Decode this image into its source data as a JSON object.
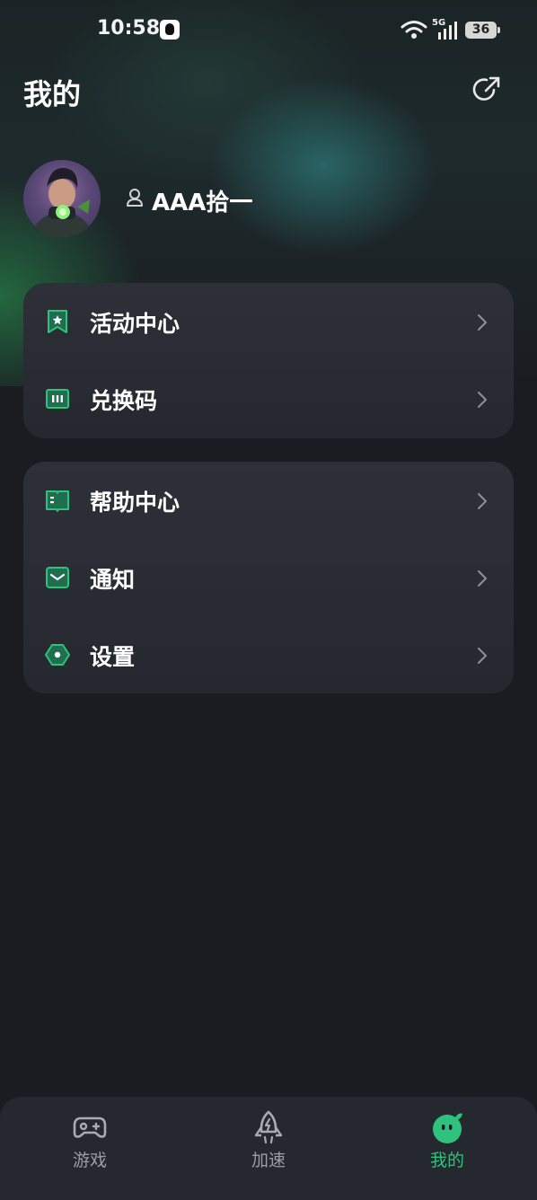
{
  "status_bar": {
    "time": "10:58",
    "network": "5G",
    "battery": "36"
  },
  "header": {
    "title": "我的"
  },
  "profile": {
    "username": "AAA拾一"
  },
  "menu_group_1": [
    {
      "label": "活动中心",
      "icon": "bookmark-star-icon"
    },
    {
      "label": "兑换码",
      "icon": "ticket-icon"
    }
  ],
  "menu_group_2": [
    {
      "label": "帮助中心",
      "icon": "book-icon"
    },
    {
      "label": "通知",
      "icon": "mail-icon"
    },
    {
      "label": "设置",
      "icon": "hexagon-gear-icon"
    }
  ],
  "tab_bar": [
    {
      "label": "游戏",
      "icon": "gamepad-icon",
      "active": false
    },
    {
      "label": "加速",
      "icon": "rocket-icon",
      "active": false
    },
    {
      "label": "我的",
      "icon": "mascot-icon",
      "active": true
    }
  ],
  "colors": {
    "accent": "#2ec27e",
    "background": "#1a1c21",
    "card": "#2b2f35",
    "inactive_tab": "#9a9ea6"
  }
}
